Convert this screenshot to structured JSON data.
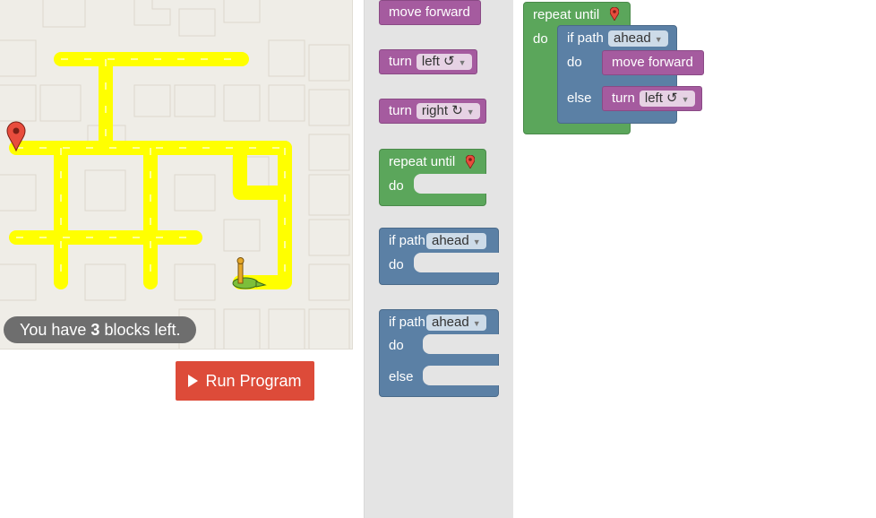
{
  "status": {
    "prefix": "You have ",
    "count": "3",
    "suffix": " blocks left."
  },
  "run_button": {
    "label": "Run Program",
    "icon": "play-icon"
  },
  "toolbox": {
    "move_forward": "move forward",
    "turn_left": {
      "label": "turn",
      "dropdown": "left ↺"
    },
    "turn_right": {
      "label": "turn",
      "dropdown": "right ↻"
    },
    "repeat_until": {
      "label": "repeat until",
      "do": "do",
      "icon": "marker-pin-icon"
    },
    "if_path": {
      "label": "if path",
      "dropdown": "ahead",
      "do": "do"
    },
    "if_else": {
      "label": "if path",
      "dropdown": "ahead",
      "do": "do",
      "else": "else"
    }
  },
  "workspace": {
    "repeat_until": {
      "label": "repeat until",
      "do": "do",
      "icon": "marker-pin-icon"
    },
    "if_path": {
      "label": "if path",
      "dropdown": "ahead",
      "do": "do",
      "else": "else"
    },
    "move_forward": "move forward",
    "turn": {
      "label": "turn",
      "dropdown": "left ↺"
    }
  },
  "maze": {
    "path_color": "#ffff00",
    "goal_icon": "marker-pin-icon",
    "player_icon": "pegman-icon"
  },
  "colors": {
    "purple": "#a55b9f",
    "green": "#5ba65b",
    "blue": "#5b80a5",
    "run": "#dd4b39"
  }
}
